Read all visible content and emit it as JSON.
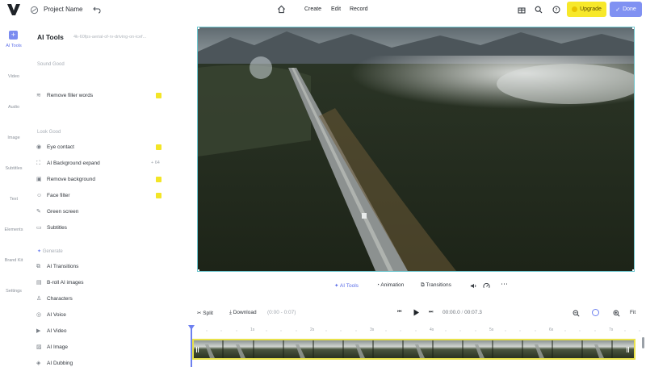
{
  "header": {
    "project_name": "Project Name",
    "nav": [
      "Create",
      "Edit",
      "Record"
    ],
    "upgrade_label": "Upgrade",
    "done_label": "Done"
  },
  "rail": {
    "items": [
      "AI Tools",
      "Video",
      "Audio",
      "Image",
      "Subtitles",
      "Text",
      "Elements",
      "Brand Kit",
      "Settings"
    ]
  },
  "panel": {
    "title": "AI Tools",
    "file_name": "4k-60fps-aerial-of-rv-driving-on-icef...",
    "sound_section": "Sound Good",
    "sound_items": [
      {
        "label": "Remove filler words",
        "icon": "waveform-icon"
      }
    ],
    "look_section": "Look Good",
    "look_items": [
      {
        "label": "Eye contact",
        "icon": "eye-icon"
      },
      {
        "label": "AI Background expand",
        "icon": "expand-icon",
        "credit": "+ 64"
      },
      {
        "label": "Remove background",
        "icon": "remove-bg-icon"
      },
      {
        "label": "Face filter",
        "icon": "face-icon"
      },
      {
        "label": "Green screen",
        "icon": "brush-icon"
      },
      {
        "label": "Subtitles",
        "icon": "subtitles-icon"
      }
    ],
    "generate_section": "Generate",
    "generate_items": [
      {
        "label": "AI Transitions",
        "icon": "transition-icon"
      },
      {
        "label": "B-roll AI images",
        "icon": "image-icon"
      },
      {
        "label": "Characters",
        "icon": "person-icon"
      },
      {
        "label": "AI Voice",
        "icon": "voice-icon"
      },
      {
        "label": "AI Video",
        "icon": "video-icon"
      },
      {
        "label": "AI Image",
        "icon": "picture-icon"
      },
      {
        "label": "AI Dubbing",
        "icon": "dubbing-icon"
      }
    ]
  },
  "video_toolbar": {
    "ai_tools": "AI Tools",
    "animation": "Animation",
    "transitions": "Transitions"
  },
  "timeline": {
    "split_label": "Split",
    "download_label": "Download",
    "download_range": "(0:00 - 0:07)",
    "current_time": "00:00.0",
    "separator": "/",
    "total_time": "00:07.3",
    "fit_label": "Fit",
    "ruler_labels": [
      "1s",
      "2s",
      "3s",
      "4s",
      "5s",
      "6s",
      "7s"
    ]
  },
  "colors": {
    "accent": "#6d80f0",
    "upgrade": "#f7e82a",
    "badge": "#f3e526",
    "selection": "#6ec6cf",
    "track_border": "#e9e24a"
  }
}
